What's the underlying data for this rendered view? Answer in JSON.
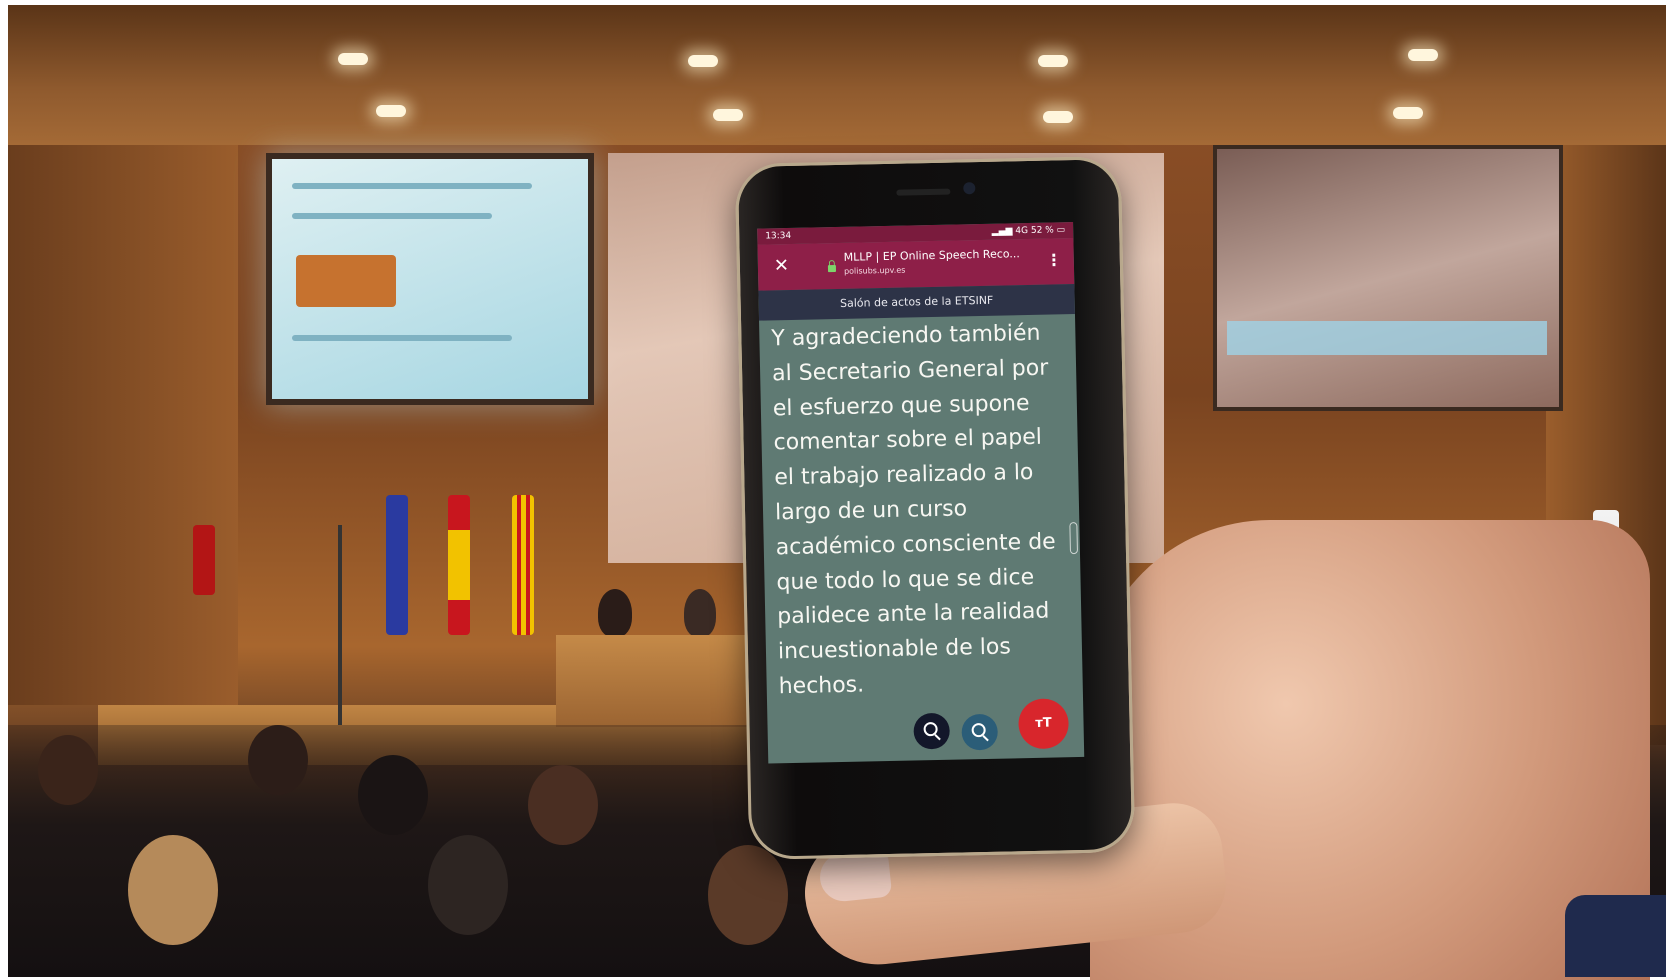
{
  "phone": {
    "status": {
      "time": "13:34",
      "network": "4G",
      "battery": "52 %"
    },
    "browser": {
      "close_label": "✕",
      "page_title": "MLLP | EP Online Speech Reco...",
      "domain": "polisubs.upv.es",
      "menu_label": "⋮"
    },
    "room": "Salón de actos de la ETSINF",
    "caption_lines": [
      "Y agradeciendo también",
      "al Secretario General por",
      "el esfuerzo que supone",
      "comentar sobre el papel",
      "el trabajo realizado a lo",
      "largo de un curso",
      "académico consciente de",
      "que todo lo que se dice",
      "palidece ante la realidad",
      "incuestionable de los",
      "hechos."
    ],
    "text_size_button": "ᴛT"
  },
  "colors": {
    "browser_bar": "#8e1f48",
    "status_bar": "#7a1b3d",
    "room_bar": "#2d3347",
    "caption_bg": "#5f7a73",
    "text_size_button": "#d8262c",
    "zoom_in_button": "#13172a",
    "zoom_out_button": "#2b5d78"
  },
  "icons": [
    "close-icon",
    "lock-icon",
    "kebab-menu-icon",
    "zoom-in-icon",
    "zoom-out-icon",
    "text-size-icon"
  ]
}
